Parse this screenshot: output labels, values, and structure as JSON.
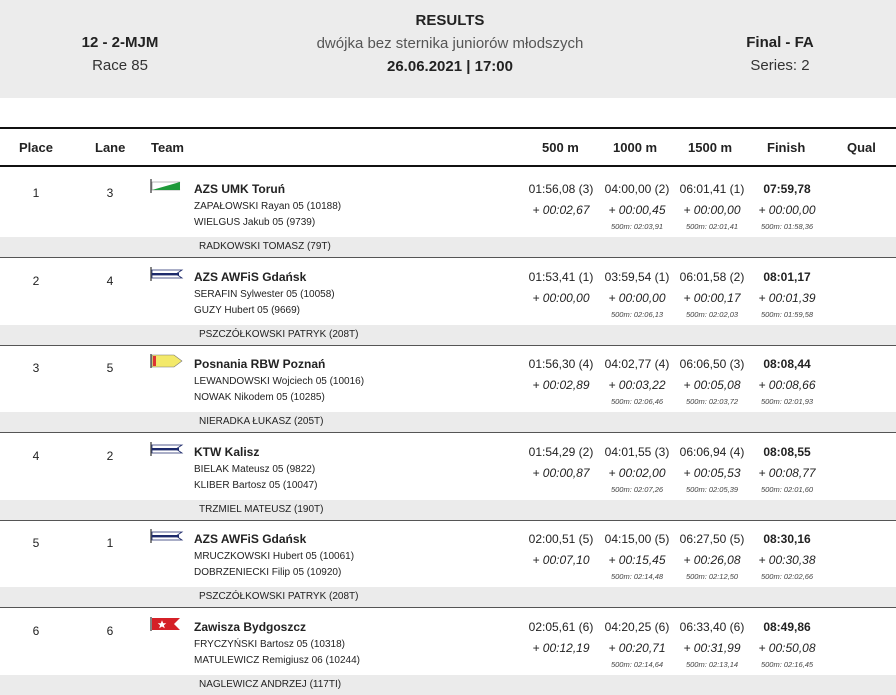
{
  "header": {
    "event_code": "12 - 2-MJM",
    "race": "Race 85",
    "title": "RESULTS",
    "subtitle": "dwójka bez sternika juniorów młodszych",
    "datetime": "26.06.2021 | 17:00",
    "final": "Final - FA",
    "series": "Series: 2"
  },
  "columns": {
    "place": "Place",
    "lane": "Lane",
    "team": "Team",
    "m500": "500 m",
    "m1000": "1000 m",
    "m1500": "1500 m",
    "finish": "Finish",
    "qual": "Qual"
  },
  "colors": {
    "header_bg": "#ececec",
    "coach_bg": "#ebebeb"
  },
  "rows": [
    {
      "place": "1",
      "lane": "3",
      "team": "AZS UMK Toruń",
      "flag_icon": "club-flag-green",
      "crew1": "ZAPAŁOWSKI  Rayan 05 (10188)",
      "crew2": "WIELGUS  Jakub 05 (9739)",
      "coach": "RADKOWSKI TOMASZ (79T)",
      "t500": "01:56,08 (3)",
      "d500": "+ 00:02,67",
      "t1000": "04:00,00 (2)",
      "d1000": "+ 00:00,45",
      "s1000": "500m: 02:03,91",
      "t1500": "06:01,41 (1)",
      "d1500": "+ 00:00,00",
      "s1500": "500m: 02:01,41",
      "tfin": "07:59,78",
      "dfin": "+ 00:00,00",
      "sfin": "500m: 01:58,36"
    },
    {
      "place": "2",
      "lane": "4",
      "team": "AZS AWFiS Gdańsk",
      "flag_icon": "club-flag-navy",
      "crew1": "SERAFIN  Sylwester 05 (10058)",
      "crew2": "GUZY  Hubert 05 (9669)",
      "coach": "PSZCZÓŁKOWSKI PATRYK (208T)",
      "t500": "01:53,41 (1)",
      "d500": "+ 00:00,00",
      "t1000": "03:59,54 (1)",
      "d1000": "+ 00:00,00",
      "s1000": "500m: 02:06,13",
      "t1500": "06:01,58 (2)",
      "d1500": "+ 00:00,17",
      "s1500": "500m: 02:02,03",
      "tfin": "08:01,17",
      "dfin": "+ 00:01,39",
      "sfin": "500m: 01:59,58"
    },
    {
      "place": "3",
      "lane": "5",
      "team": "Posnania RBW Poznań",
      "flag_icon": "club-flag-yellow",
      "crew1": "LEWANDOWSKI  Wojciech 05 (10016)",
      "crew2": "NOWAK  Nikodem 05 (10285)",
      "coach": "NIERADKA ŁUKASZ (205T)",
      "t500": "01:56,30 (4)",
      "d500": "+ 00:02,89",
      "t1000": "04:02,77 (4)",
      "d1000": "+ 00:03,22",
      "s1000": "500m: 02:06,46",
      "t1500": "06:06,50 (3)",
      "d1500": "+ 00:05,08",
      "s1500": "500m: 02:03,72",
      "tfin": "08:08,44",
      "dfin": "+ 00:08,66",
      "sfin": "500m: 02:01,93"
    },
    {
      "place": "4",
      "lane": "2",
      "team": "KTW Kalisz",
      "flag_icon": "club-flag-navy",
      "crew1": "BIELAK  Mateusz 05 (9822)",
      "crew2": "KLIBER  Bartosz 05 (10047)",
      "coach": "TRZMIEL MATEUSZ (190T)",
      "t500": "01:54,29 (2)",
      "d500": "+ 00:00,87",
      "t1000": "04:01,55 (3)",
      "d1000": "+ 00:02,00",
      "s1000": "500m: 02:07,26",
      "t1500": "06:06,94 (4)",
      "d1500": "+ 00:05,53",
      "s1500": "500m: 02:05,39",
      "tfin": "08:08,55",
      "dfin": "+ 00:08,77",
      "sfin": "500m: 02:01,60"
    },
    {
      "place": "5",
      "lane": "1",
      "team": "AZS AWFiS Gdańsk",
      "flag_icon": "club-flag-navy",
      "crew1": "MRUCZKOWSKI  Hubert 05 (10061)",
      "crew2": "DOBRZENIECKI  Filip 05 (10920)",
      "coach": "PSZCZÓŁKOWSKI PATRYK (208T)",
      "t500": "02:00,51 (5)",
      "d500": "+ 00:07,10",
      "t1000": "04:15,00 (5)",
      "d1000": "+ 00:15,45",
      "s1000": "500m: 02:14,48",
      "t1500": "06:27,50 (5)",
      "d1500": "+ 00:26,08",
      "s1500": "500m: 02:12,50",
      "tfin": "08:30,16",
      "dfin": "+ 00:30,38",
      "sfin": "500m: 02:02,66"
    },
    {
      "place": "6",
      "lane": "6",
      "team": "Zawisza Bydgoszcz",
      "flag_icon": "club-flag-red-star",
      "crew1": "FRYCZYŃSKI  Bartosz 05 (10318)",
      "crew2": "MATULEWICZ  Remigiusz 06 (10244)",
      "coach": "NAGLEWICZ ANDRZEJ (117TI)",
      "t500": "02:05,61 (6)",
      "d500": "+ 00:12,19",
      "t1000": "04:20,25 (6)",
      "d1000": "+ 00:20,71",
      "s1000": "500m: 02:14,64",
      "t1500": "06:33,40 (6)",
      "d1500": "+ 00:31,99",
      "s1500": "500m: 02:13,14",
      "tfin": "08:49,86",
      "dfin": "+ 00:50,08",
      "sfin": "500m: 02:16,45"
    }
  ]
}
